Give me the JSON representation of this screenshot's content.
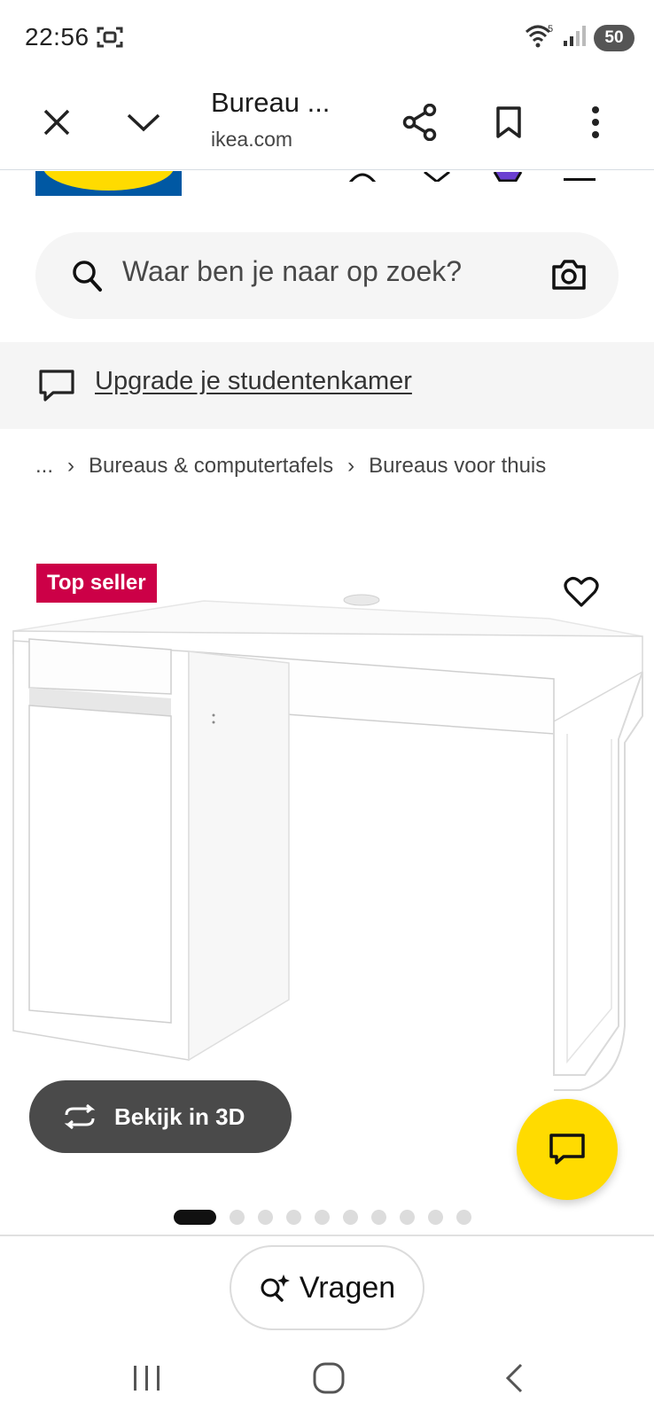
{
  "status_bar": {
    "time": "22:56",
    "signal_label": "5",
    "battery": "50"
  },
  "browser": {
    "title": "Bureau ...",
    "url": "ikea.com",
    "icons": [
      "close-icon",
      "chevron-down-icon",
      "share-icon",
      "bookmark-icon",
      "more-vert-icon"
    ]
  },
  "header": {
    "icons": [
      "ikea-logo",
      "account-icon",
      "heart-icon",
      "shopping-bag-icon",
      "menu-icon"
    ],
    "brand_colors": {
      "blue": "#0058a3",
      "yellow": "#ffdb00"
    }
  },
  "search": {
    "placeholder": "Waar ben je naar op zoek?",
    "icons": [
      "search-icon",
      "camera-icon"
    ]
  },
  "promo": {
    "link": "Upgrade je studentenkamer",
    "icon": "chat-bubble-icon"
  },
  "breadcrumb": {
    "items": [
      "...",
      "Bureaus & computertafels",
      "Bureaus voor thuis"
    ]
  },
  "product": {
    "badge": "Top seller",
    "badge_color": "#cc0047",
    "view_3d_label": "Bekijk in 3D",
    "image_count": 10,
    "active_image": 1
  },
  "ask": {
    "label": "Vragen"
  },
  "nav": {
    "icons": [
      "recent-apps-icon",
      "home-icon",
      "back-icon"
    ]
  }
}
